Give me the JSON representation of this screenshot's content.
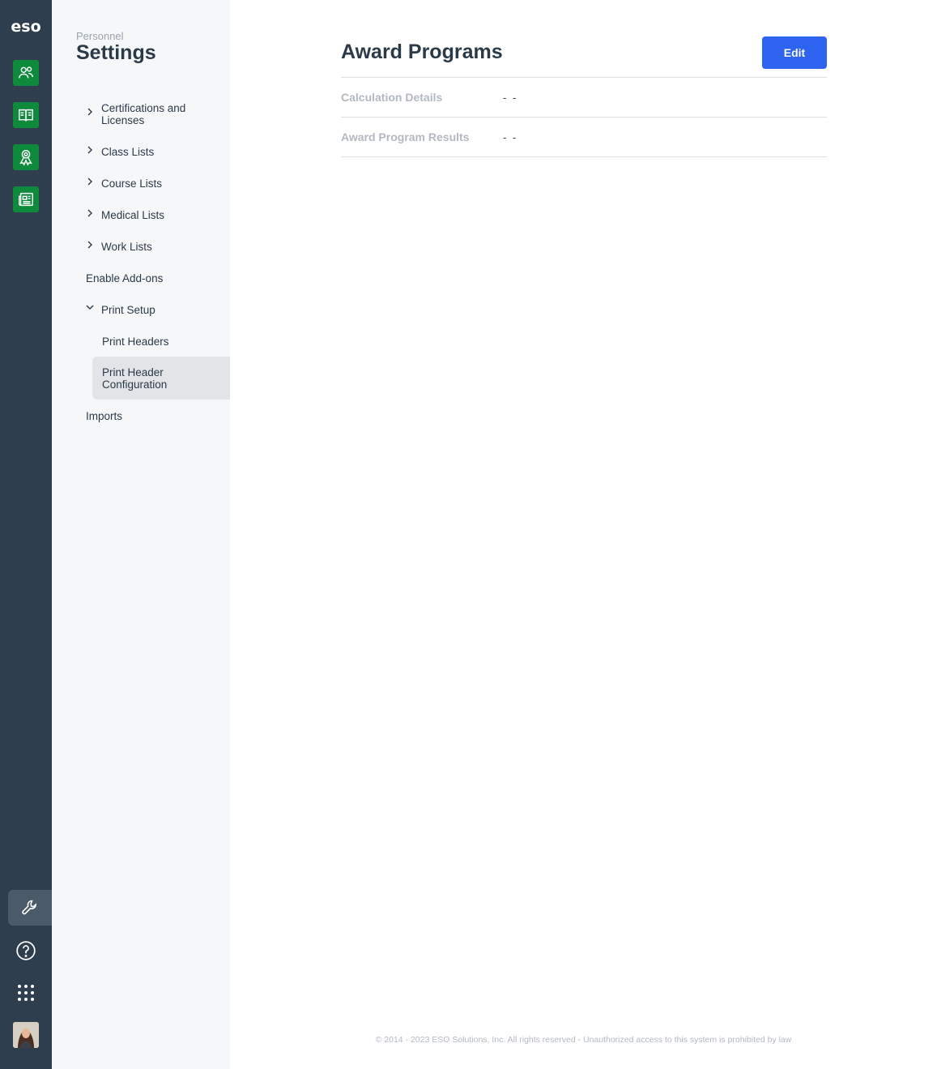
{
  "rail": {
    "logo": "eso",
    "apps": [
      {
        "name": "personnel",
        "icon": "people-icon"
      },
      {
        "name": "training",
        "icon": "book-icon"
      },
      {
        "name": "awards",
        "icon": "award-ribbon-icon"
      },
      {
        "name": "news",
        "icon": "newspaper-icon"
      }
    ],
    "bottom_icons": [
      "wrench-icon",
      "help-circle-icon",
      "apps-grid-icon",
      "avatar"
    ],
    "accent": "#0d8a3c",
    "background": "#2e3e4e"
  },
  "sidebar": {
    "overline": "Personnel",
    "title": "Settings",
    "items": [
      {
        "label": "Certifications and Licenses",
        "expanded": false
      },
      {
        "label": "Class Lists",
        "expanded": false
      },
      {
        "label": "Course Lists",
        "expanded": false
      },
      {
        "label": "Medical Lists",
        "expanded": false
      },
      {
        "label": "Work Lists",
        "expanded": false
      },
      {
        "label": "Enable Add-ons"
      },
      {
        "label": "Print Setup",
        "expanded": true
      },
      {
        "label": "Imports"
      }
    ],
    "print_setup_children": [
      {
        "label": "Print Headers",
        "active": false
      },
      {
        "label": "Print Header Configuration",
        "active": true
      }
    ]
  },
  "main": {
    "title": "Award Programs",
    "edit_label": "Edit",
    "edit_color": "#2e63f0",
    "rows": [
      {
        "label": "Calculation Details",
        "value": "- -"
      },
      {
        "label": "Award Program Results",
        "value": "- -"
      }
    ],
    "footer": "© 2014 - 2023 ESO Solutions, Inc. All rights reserved - Unauthorized access to this system is prohibited by law"
  }
}
